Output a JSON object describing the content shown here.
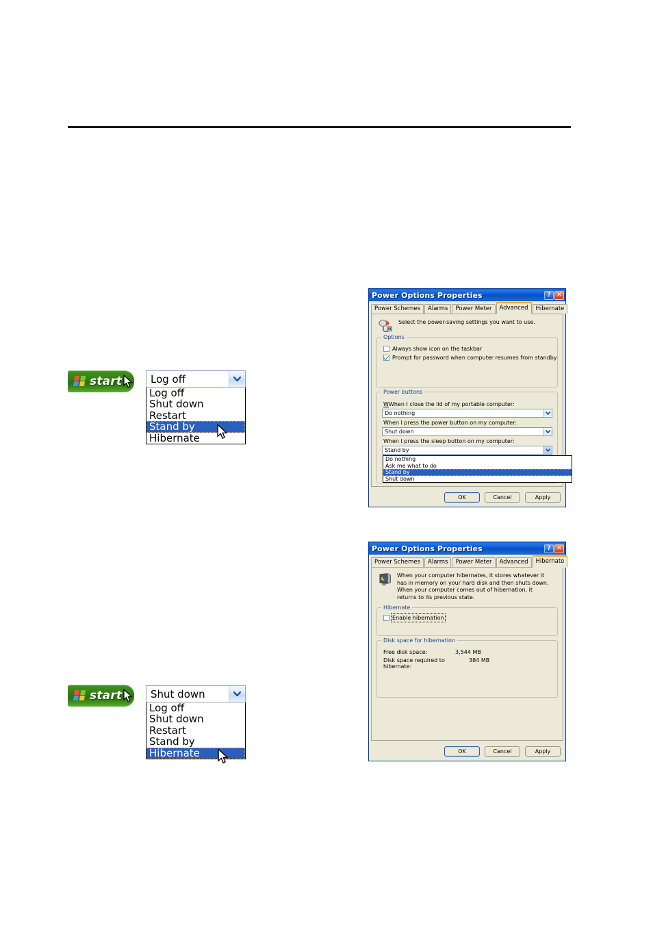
{
  "page": {
    "rule": ""
  },
  "start_menu_1": {
    "start_label": "start",
    "combo_value": "Log off",
    "options": [
      "Log off",
      "Shut down",
      "Restart",
      "Stand by",
      "Hibernate"
    ],
    "selected": "Stand by",
    "selected_index": 3
  },
  "start_menu_2": {
    "start_label": "start",
    "combo_value": "Shut down",
    "options": [
      "Log off",
      "Shut down",
      "Restart",
      "Stand by",
      "Hibernate"
    ],
    "selected": "Hibernate",
    "selected_index": 4
  },
  "dialog_advanced": {
    "title": "Power Options Properties",
    "help_button": "?",
    "close_button": "✕",
    "tabs": [
      "Power Schemes",
      "Alarms",
      "Power Meter",
      "Advanced",
      "Hibernate"
    ],
    "active_tab": "Advanced",
    "description": "Select the power-saving settings you want to use.",
    "options_group": {
      "label": "Options",
      "checkbox_taskbar": {
        "label": "Always show icon on the taskbar",
        "checked": false
      },
      "checkbox_password": {
        "label": "Prompt for password when computer resumes from standby",
        "checked": true
      }
    },
    "power_buttons_group": {
      "label": "Power buttons",
      "lid_label": "When I close the lid of my portable computer:",
      "lid_value": "Do nothing",
      "power_label": "When I press the power button on my computer:",
      "power_value": "Shut down",
      "sleep_label": "When I press the sleep button on my computer:",
      "sleep_value": "Stand by",
      "sleep_options": [
        "Do nothing",
        "Ask me what to do",
        "Stand by",
        "Shut down"
      ],
      "sleep_selected_index": 2
    },
    "buttons": {
      "ok": "OK",
      "cancel": "Cancel",
      "apply": "Apply"
    }
  },
  "dialog_hibernate": {
    "title": "Power Options Properties",
    "help_button": "?",
    "close_button": "✕",
    "tabs": [
      "Power Schemes",
      "Alarms",
      "Power Meter",
      "Advanced",
      "Hibernate"
    ],
    "active_tab": "Hibernate",
    "description": "When your computer hibernates, it stores whatever it has in memory on your hard disk and then shuts down. When your computer comes out of hibernation, it returns to its previous state.",
    "hibernate_group": {
      "label": "Hibernate",
      "checkbox_enable": {
        "label": "Enable hibernation",
        "checked": false
      }
    },
    "disk_group": {
      "label": "Disk space for hibernation",
      "free_label": "Free disk space:",
      "free_value": "3,544 MB",
      "required_label": "Disk space required to hibernate:",
      "required_value": "384 MB"
    },
    "buttons": {
      "ok": "OK",
      "cancel": "Cancel",
      "apply": "Apply"
    }
  },
  "colors": {
    "title_blue": "#0e54be",
    "dialog_face": "#ece9d8",
    "highlight_blue": "#2a5fbe",
    "group_label": "#15428b",
    "tab_accent": "#f5a823",
    "start_green": "#2f7a12"
  }
}
